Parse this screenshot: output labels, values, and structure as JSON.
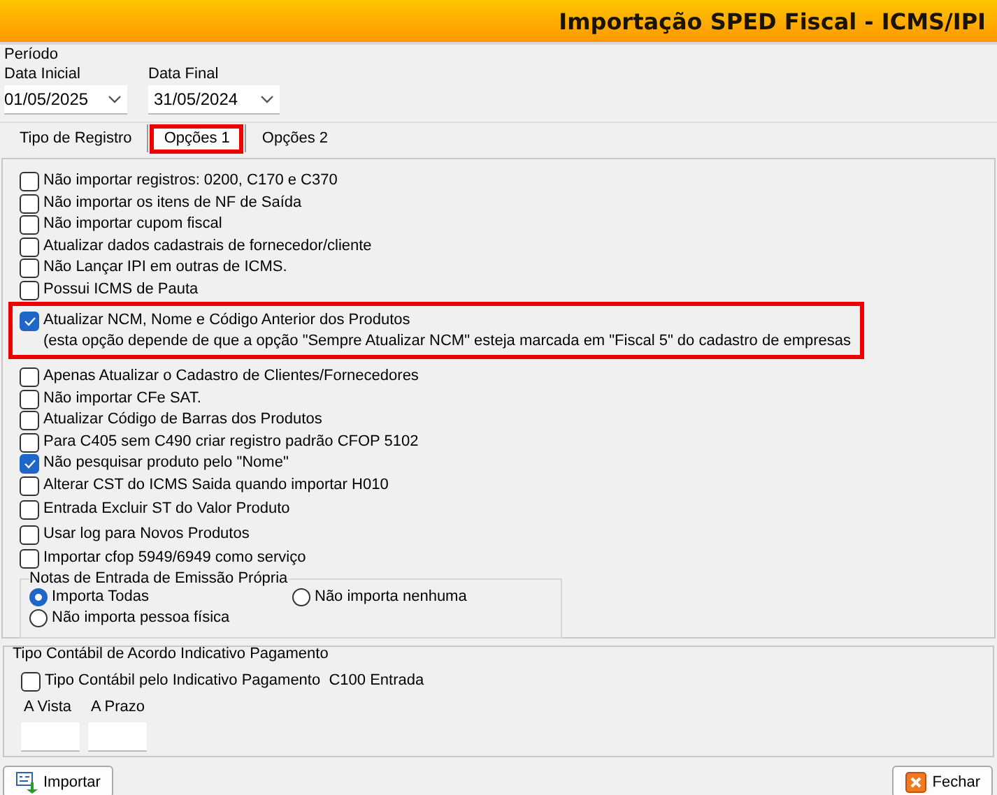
{
  "window": {
    "title": "Importação SPED Fiscal - ICMS/IPI"
  },
  "period": {
    "legend": "Período",
    "fields": [
      {
        "label": "Data Inicial",
        "value": "01/05/2025"
      },
      {
        "label": "Data Final",
        "value": "31/05/2024"
      }
    ]
  },
  "tabs": [
    {
      "label": "Tipo de Registro",
      "selected": false,
      "highlighted": false
    },
    {
      "label": "Opções 1",
      "selected": true,
      "highlighted": true
    },
    {
      "label": "Opções 2",
      "selected": false,
      "highlighted": false
    }
  ],
  "options": [
    {
      "label": "Não importar registros: 0200, C170 e C370",
      "checked": false,
      "highlighted": false
    },
    {
      "label": "Não importar os itens de NF de Saída",
      "checked": false,
      "highlighted": false
    },
    {
      "label": "Não importar cupom fiscal",
      "checked": false,
      "highlighted": false
    },
    {
      "label": "Atualizar dados cadastrais de fornecedor/cliente",
      "checked": false,
      "highlighted": false
    },
    {
      "label": "Não Lançar IPI em outras de ICMS.",
      "checked": false,
      "highlighted": false
    },
    {
      "label": "Possui ICMS de Pauta",
      "checked": false,
      "highlighted": false
    },
    {
      "label": "Atualizar NCM, Nome e Código Anterior dos Produtos",
      "note": "(esta opção depende de que a opção \"Sempre Atualizar NCM\" esteja marcada em \"Fiscal 5\" do cadastro de empresas",
      "checked": true,
      "highlighted": true
    },
    {
      "label": "Apenas Atualizar o Cadastro de Clientes/Fornecedores",
      "checked": false,
      "highlighted": false
    },
    {
      "label": "Não importar CFe SAT.",
      "checked": false,
      "highlighted": false
    },
    {
      "label": "Atualizar Código de Barras dos Produtos",
      "checked": false,
      "highlighted": false
    },
    {
      "label": "Para C405 sem C490 criar registro padrão CFOP 5102",
      "checked": false,
      "highlighted": false
    },
    {
      "label": "Não pesquisar produto pelo \"Nome\"",
      "checked": true,
      "highlighted": false
    },
    {
      "label": "Alterar CST do ICMS Saida quando importar H010",
      "checked": false,
      "highlighted": false
    },
    {
      "label": "Entrada Excluir ST do Valor Produto",
      "checked": false,
      "highlighted": false
    },
    {
      "label": "Usar log para Novos Produtos",
      "checked": false,
      "highlighted": false
    },
    {
      "label": "Importar cfop 5949/6949 como serviço",
      "checked": false,
      "highlighted": false
    }
  ],
  "own_issue_notes": {
    "legend": "Notas de Entrada de Emissão Própria",
    "radios": [
      {
        "label": "Importa Todas",
        "selected": true
      },
      {
        "label": "Não importa nenhuma",
        "selected": false
      },
      {
        "label": "Não importa pessoa física",
        "selected": false
      }
    ]
  },
  "payment_type": {
    "legend": "Tipo Contábil de Acordo Indicativo Pagamento",
    "checkbox": {
      "label": "Tipo Contábil pelo Indicativo Pagamento  C100 Entrada",
      "checked": false
    },
    "fields": [
      {
        "label": "A Vista"
      },
      {
        "label": "A Prazo"
      }
    ]
  },
  "buttons": [
    {
      "label": "Importar",
      "kind": "import"
    },
    {
      "label": "Fechar",
      "kind": "close"
    }
  ]
}
